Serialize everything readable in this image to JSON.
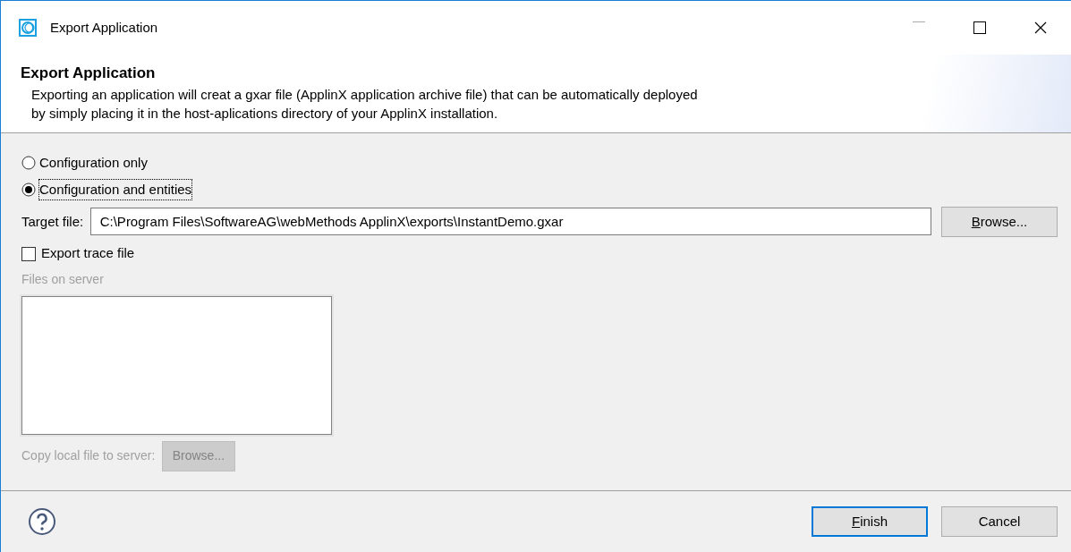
{
  "window": {
    "title": "Export Application"
  },
  "header": {
    "title": "Export Application",
    "description": "Exporting an application will creat a gxar file (ApplinX application archive file) that can be automatically deployed\nby simply placing it in the host-aplications directory of your ApplinX installation."
  },
  "options": [
    {
      "label": "Configuration only",
      "selected": false,
      "focused": false
    },
    {
      "label": "Configuration and entities",
      "selected": true,
      "focused": true
    }
  ],
  "target_file": {
    "label": "Target file:",
    "value": "C:\\Program Files\\SoftwareAG\\webMethods ApplinX\\exports\\InstantDemo.gxar",
    "button": {
      "label": "Browse...",
      "mnemonic": true,
      "disabled": false
    }
  },
  "export_trace": {
    "label": "Export trace file",
    "checked": false
  },
  "server_files": {
    "label": "Files on server",
    "disabled": true
  },
  "copy_local": {
    "label": "Copy local file to server:",
    "button": {
      "label": "Browse...",
      "mnemonic": false,
      "disabled": true
    }
  },
  "buttons": [
    {
      "label": "Finish",
      "mnemonic": true,
      "default": true
    },
    {
      "label": "Cancel",
      "mnemonic": false,
      "default": false
    }
  ]
}
